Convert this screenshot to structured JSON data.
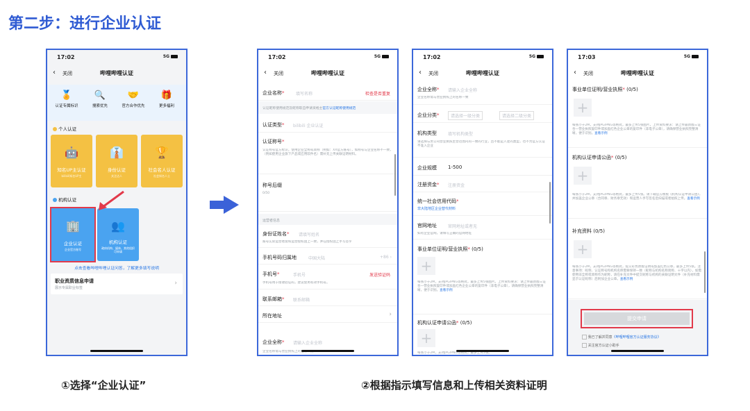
{
  "title": "第二步：进行企业认证",
  "captions": {
    "left": "①选择“企业认证”",
    "right": "②根据指示填写信息和上传相关资料证明"
  },
  "status": {
    "time1": "17:02",
    "time4": "17:03",
    "signal": "5G"
  },
  "nav": {
    "close": "关闭",
    "title": "哔哩哔哩认证",
    "back": "‹"
  },
  "p1": {
    "benefits": [
      "认证专属标识",
      "搜索优先",
      "官方合作优先",
      "更多福利"
    ],
    "personal_title": "个人认证",
    "tiles": [
      {
        "name": "知名UP主认证",
        "sub": "bilibili知名UP主"
      },
      {
        "name": "身份认证",
        "sub": "关注达人"
      },
      {
        "name": "社会名人认证",
        "sub": "社会知名人士"
      }
    ],
    "org_title": "机构认证",
    "enterprise": {
      "name": "企业认证",
      "sub": "企业官方账号"
    },
    "institution": {
      "name": "机构认证",
      "sub": "政府机构、媒体、其他组织可申请"
    },
    "link_text": "点击查看哔哩哔哩认证问答，了解更多填写说明",
    "job_title": "职业资质信息申请",
    "job_sub": "展示专属职业标签"
  },
  "p2": {
    "company_name": "企业名称",
    "company_name_ph": "填写名称",
    "check_dup": "检查是否重复",
    "tip": "认证昵称使用规范及昵称取自申请资格主",
    "tip_link": "官方认证昵称使用规范",
    "auth_type": "认证类型",
    "auth_type_val": "bilibili 企业认证",
    "auth_name": "认证称号",
    "auth_name_desc": "认证称号官方标识，使用企业全称或简称（例如：XX官方账号），如称号与企业名称不一致，（例如使用企业旗下产品或应用软件名）需补充上传关联证明材料。",
    "suffix": "称号后缀",
    "suffix_count": "0/50",
    "operator": "运营者信息",
    "id_name": "身份证姓名",
    "id_name_ph": "请填写姓名",
    "id_desc": "账号实际运营者需和运营授权函上一致，并在授权函上手写签字",
    "phone_area": "手机号码归属地",
    "phone_area_val": "中国大陆",
    "phone_code": "+86 ›",
    "phone": "手机号",
    "phone_ph": "手机号",
    "send_code": "发送验证码",
    "phone_desc": "手机号用于接收验证码，建议使用有效手机号。",
    "email": "联系邮箱",
    "email_ph": "联系邮箱",
    "address": "所在地址",
    "full_name": "企业全称",
    "full_name_ph": "请输入企业全称",
    "full_name_desc": "企业名称需与营业执照上的名称一致"
  },
  "p3": {
    "full_name": "企业全称",
    "full_name_ph": "请输入企业全称",
    "full_name_desc": "企业名称需与营业执照上的名称一致",
    "category": "企业分类",
    "cat1": "请选择一级分类",
    "cat2": "请选择二级分类",
    "org_type": "机构类型",
    "org_type_ph": "填写机构类型",
    "org_type_desc": "请选择与贵公司营业执照主营范围内的一致的行业，且不能是入驻的类型，也不为官方认证不准入企业",
    "scale": "企业规模",
    "scale_val": "1-500",
    "capital": "注册资金",
    "capital_ph": "注册资金",
    "credit_code": "统一社会信用代码",
    "credit_sub": "非大陆地区企业替代材料",
    "website": "官网地址",
    "website_ph": "官网地址或者无",
    "website_desc": "如有企业官网，请填写正确的官网地址",
    "license": "事业单位证明/营业执照",
    "license_count": "(0/5)",
    "license_note": "每张小于2M，支持JPG/PNG等格式，最多上传5张图片。上传资料要求：请上传最新版三证合一营业执照复印件或加盖红色企业公章的复印件（非电子公章），请确保营业执照完整清晰，便于识别。",
    "license_link": "查看示例",
    "letter": "机构认证申请公函",
    "letter_count": "(0/5)",
    "letter_note": "每张小于2M，支持JPG/PNG等格式，最多上传5张。"
  },
  "p4": {
    "license": "事业单位证明/营业执照",
    "license_count": "(0/5)",
    "license_note": "每张小于2M，支持JPG/PNG等格式，最多上传5张图片，上传资料要求：请上传最新版三证合一营业执照复印件或加盖红色企业公章的复印件（非电子公章），请确保营业执照完整清晰，便于识别。",
    "letter": "机构认证申请公函",
    "letter_count": "(0/5)",
    "letter_note": "每张小于2M，支持JPG/PNG等格式，最多上传5张。请下载官方模板《机构认证申请公函》，并加盖企业公章（合同章、财务章无效）和运营人手写签名后扫描或者拍照上传。",
    "extra": "补充资料",
    "extra_count": "(0/5)",
    "extra_note": "每张小于2M，支持JPG/PNG等格式，提交彩色原版证明或加盖红色公章，最多上传5张。注意事项：昵称、认证称号和机构名称需要保持一致（昵称与机构名称简称、十字以内），如需使用非全称或简称作为昵称，请在补充文件中提交昵称与机构的关联证明文件（补充材料需显示认证昵称）后附加企业公章。",
    "example": "查看示例",
    "submit": "提交申请",
    "agree_prefix": "我已了解并同意",
    "agree_link": "《哔哩哔哩官方认证服务协议》",
    "follow": "关注官方认证小助手"
  },
  "colors": {
    "accent": "#2f5bd3",
    "yellow": "#f4c143",
    "blue": "#4aa3f0",
    "red": "#e2394a"
  }
}
